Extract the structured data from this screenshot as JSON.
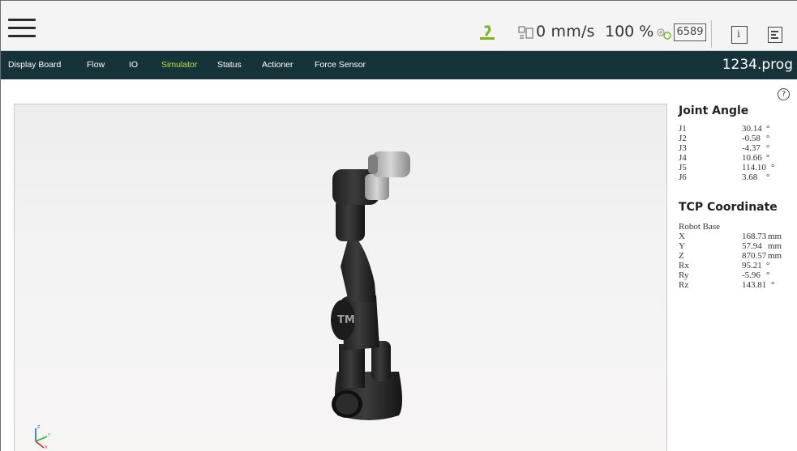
{
  "topbar": {
    "speed_text": "0 mm/s",
    "speed_percent": "100 %",
    "counter": "6589"
  },
  "nav": {
    "items": [
      {
        "label": "Display Board",
        "active": false
      },
      {
        "label": "Flow",
        "active": false
      },
      {
        "label": "IO",
        "active": false
      },
      {
        "label": "Simulator",
        "active": true
      },
      {
        "label": "Status",
        "active": false
      },
      {
        "label": "Actioner",
        "active": false
      },
      {
        "label": "Force Sensor",
        "active": false
      }
    ],
    "program_name": "1234.prog"
  },
  "help": {
    "symbol": "?"
  },
  "joint_angle": {
    "title": "Joint Angle",
    "unit": "°",
    "rows": [
      {
        "label": "J1",
        "value": "30.14"
      },
      {
        "label": "J2",
        "value": "-0.58"
      },
      {
        "label": "J3",
        "value": "-4.37"
      },
      {
        "label": "J4",
        "value": "10.66"
      },
      {
        "label": "J5",
        "value": "114.10"
      },
      {
        "label": "J6",
        "value": "3.68"
      }
    ]
  },
  "tcp": {
    "title": "TCP Coordinate",
    "base_label": "Robot Base",
    "rows": [
      {
        "label": "X",
        "value": "168.73",
        "unit": "mm"
      },
      {
        "label": "Y",
        "value": "57.94",
        "unit": "mm"
      },
      {
        "label": "Z",
        "value": "870.57",
        "unit": "mm"
      },
      {
        "label": "Rx",
        "value": "95.21",
        "unit": "°"
      },
      {
        "label": "Ry",
        "value": "-5.96",
        "unit": "°"
      },
      {
        "label": "Rz",
        "value": "143.81",
        "unit": "°"
      }
    ]
  },
  "axes_triad": {
    "x": "X",
    "y": "Y",
    "z": "Z"
  },
  "robot_logo": "TM",
  "colors": {
    "nav_bg": "#153338",
    "nav_active": "#b9e34a",
    "status_green": "#7cb518"
  }
}
